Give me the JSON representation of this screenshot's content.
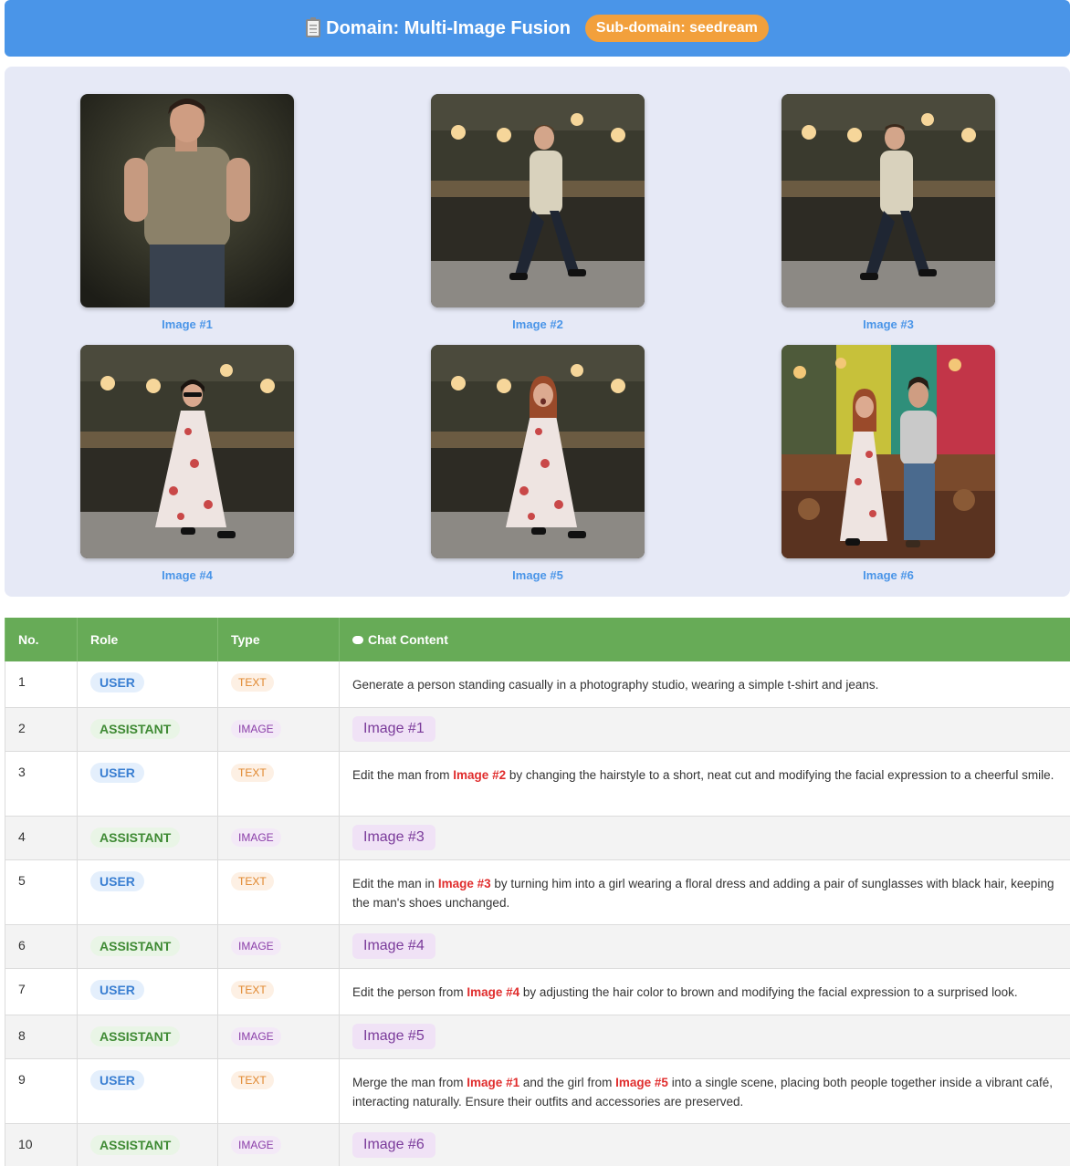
{
  "header": {
    "title": "Domain: Multi-Image Fusion",
    "subdomain": "Sub-domain: seedream",
    "icon": "clipboard-icon"
  },
  "gallery": [
    {
      "caption": "Image #1"
    },
    {
      "caption": "Image #2"
    },
    {
      "caption": "Image #3"
    },
    {
      "caption": "Image #4"
    },
    {
      "caption": "Image #5"
    },
    {
      "caption": "Image #6"
    }
  ],
  "table": {
    "headers": {
      "no": "No.",
      "role": "Role",
      "type": "Type",
      "content": "Chat Content"
    },
    "rows": [
      {
        "no": "1",
        "role": "USER",
        "type": "TEXT",
        "parts": [
          "Generate a person standing casually in a photography studio, wearing a simple t-shirt and jeans."
        ]
      },
      {
        "no": "2",
        "role": "ASSISTANT",
        "type": "IMAGE",
        "image": "Image #1"
      },
      {
        "no": "3",
        "role": "USER",
        "type": "TEXT",
        "parts": [
          "Edit the man from ",
          "Image #2",
          " by changing the hairstyle to a short, neat cut and modifying the facial expression to a cheerful smile."
        ]
      },
      {
        "no": "4",
        "role": "ASSISTANT",
        "type": "IMAGE",
        "image": "Image #3"
      },
      {
        "no": "5",
        "role": "USER",
        "type": "TEXT",
        "parts": [
          "Edit the man in ",
          "Image #3",
          " by turning him into a girl wearing a floral dress and adding a pair of sunglasses with black hair, keeping the man's shoes unchanged."
        ]
      },
      {
        "no": "6",
        "role": "ASSISTANT",
        "type": "IMAGE",
        "image": "Image #4"
      },
      {
        "no": "7",
        "role": "USER",
        "type": "TEXT",
        "parts": [
          "Edit the person from ",
          "Image #4",
          " by adjusting the hair color to brown and modifying the facial expression to a surprised look."
        ]
      },
      {
        "no": "8",
        "role": "ASSISTANT",
        "type": "IMAGE",
        "image": "Image #5"
      },
      {
        "no": "9",
        "role": "USER",
        "type": "TEXT",
        "parts": [
          "Merge the man from ",
          "Image #1",
          " and the girl from ",
          "Image #5",
          " into a single scene, placing both people together inside a vibrant café, interacting naturally. Ensure their outfits and accessories are preserved."
        ]
      },
      {
        "no": "10",
        "role": "ASSISTANT",
        "type": "IMAGE",
        "image": "Image #6"
      }
    ]
  }
}
